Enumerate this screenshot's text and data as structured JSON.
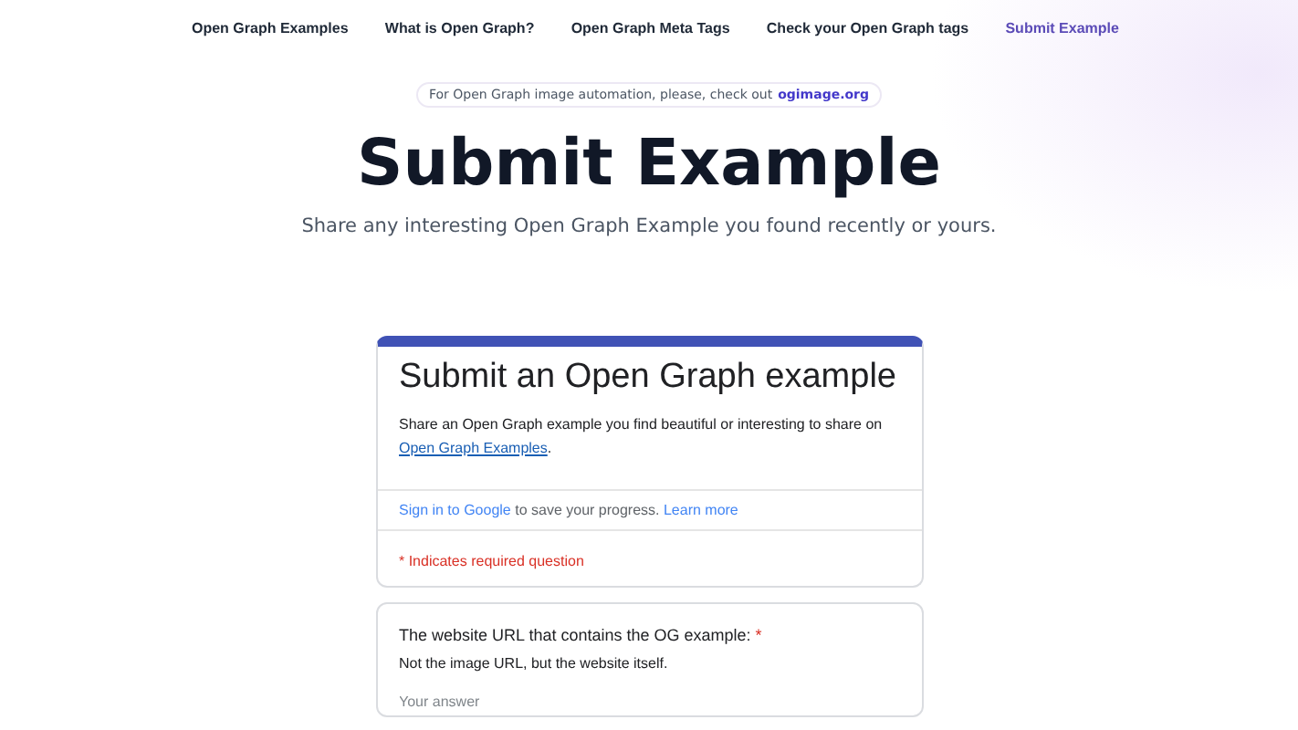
{
  "nav": [
    {
      "label": "Open Graph Examples",
      "selected": false
    },
    {
      "label": "What is Open Graph?",
      "selected": false
    },
    {
      "label": "Open Graph Meta Tags",
      "selected": false
    },
    {
      "label": "Check your Open Graph tags",
      "selected": false
    },
    {
      "label": "Submit Example",
      "selected": true
    }
  ],
  "banner": {
    "text": "For Open Graph image automation, please, check out",
    "link": "ogimage.org"
  },
  "title": "Submit Example",
  "subtitle": "Share any interesting Open Graph Example you found recently or yours.",
  "form": {
    "title": "Submit an Open Graph example",
    "description": "Share an Open Graph example you find beautiful or interesting to share on",
    "description_link": "Open Graph Examples",
    "description_end": ".",
    "signin": {
      "link": "Sign in to Google",
      "text": "to save your progress.",
      "learn_more": "Learn more"
    },
    "required_note": "* Indicates required question",
    "questions": [
      {
        "label": "The website URL that contains the OG example:",
        "required": true,
        "required_mark": "*",
        "hint": "Not the image URL, but the website itself.",
        "placeholder": "Your answer"
      }
    ]
  }
}
